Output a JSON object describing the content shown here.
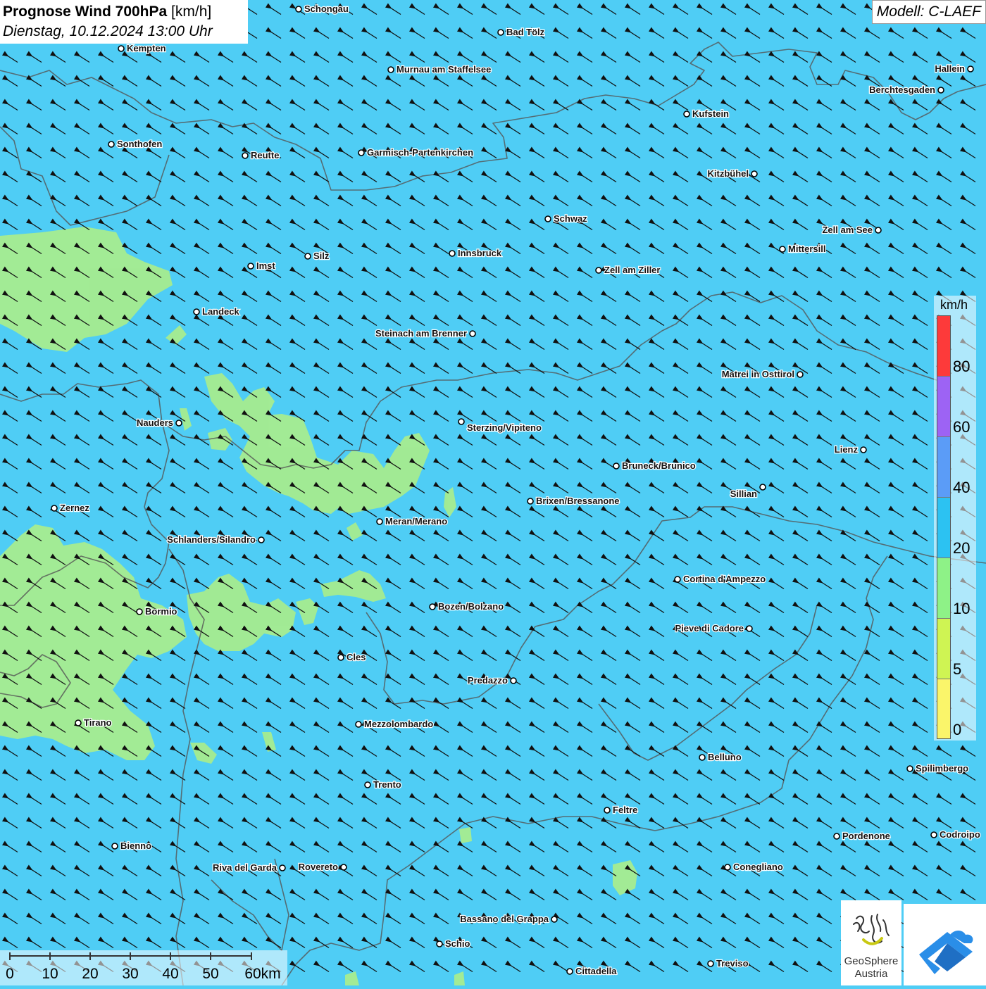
{
  "header": {
    "title_bold": "Prognose Wind 700hPa",
    "title_unit": "[km/h]",
    "datetime": "Dienstag, 10.12.2024 13:00 Uhr"
  },
  "model": "Modell: C-LAEF",
  "legend": {
    "unit": "km/h",
    "labels": [
      "80",
      "60",
      "40",
      "20",
      "10",
      "5",
      "0"
    ],
    "colors": [
      "#fd3a3a",
      "#9d63f4",
      "#5b9cf7",
      "#2cc2f2",
      "#8ef287",
      "#cff453",
      "#faf56a"
    ]
  },
  "scalebar": {
    "labels": [
      "0",
      "10",
      "20",
      "30",
      "40",
      "50",
      "60km"
    ]
  },
  "logos": {
    "geosphere_line1": "GeoSphere",
    "geosphere_line2": "Austria"
  },
  "map": {
    "base_color": "#4fcdf5",
    "low_wind_color": "#a6ec8f",
    "wind_direction": "from south-east (arrows pointing north-west)",
    "cities": [
      {
        "name": "Schongau"
      },
      {
        "name": "Bad Tölz"
      },
      {
        "name": "Kempten"
      },
      {
        "name": "Murnau am Staffelsee"
      },
      {
        "name": "Hallein"
      },
      {
        "name": "Berchtesgaden"
      },
      {
        "name": "Kufstein"
      },
      {
        "name": "Sonthofen"
      },
      {
        "name": "Reutte"
      },
      {
        "name": "Garmisch-Partenkirchen"
      },
      {
        "name": "Kitzbühel"
      },
      {
        "name": "Schwaz"
      },
      {
        "name": "Zell am See"
      },
      {
        "name": "Mittersill"
      },
      {
        "name": "Imst"
      },
      {
        "name": "Silz"
      },
      {
        "name": "Innsbruck"
      },
      {
        "name": "Zell am Ziller"
      },
      {
        "name": "Landeck"
      },
      {
        "name": "Steinach am Brenner"
      },
      {
        "name": "Matrei in Osttirol"
      },
      {
        "name": "Nauders"
      },
      {
        "name": "Sterzing/Vipiteno"
      },
      {
        "name": "Lienz"
      },
      {
        "name": "Bruneck/Brunico"
      },
      {
        "name": "Sillian"
      },
      {
        "name": "Zernez"
      },
      {
        "name": "Brixen/Bressanone"
      },
      {
        "name": "Meran/Merano"
      },
      {
        "name": "Schlanders/Silandro"
      },
      {
        "name": "Cortina d'Ampezzo"
      },
      {
        "name": "Bozen/Bolzano"
      },
      {
        "name": "Bormio"
      },
      {
        "name": "Pieve di Cadore"
      },
      {
        "name": "Cles"
      },
      {
        "name": "Predazzo"
      },
      {
        "name": "Tirano"
      },
      {
        "name": "Mezzolombardo"
      },
      {
        "name": "Belluno"
      },
      {
        "name": "Spilimbergo"
      },
      {
        "name": "Trento"
      },
      {
        "name": "Feltre"
      },
      {
        "name": "Pordenone"
      },
      {
        "name": "Codroipo"
      },
      {
        "name": "Bienno"
      },
      {
        "name": "Riva del Garda"
      },
      {
        "name": "Rovereto"
      },
      {
        "name": "Conegliano"
      },
      {
        "name": "Bassano del Grappa"
      },
      {
        "name": "Schio"
      },
      {
        "name": "Treviso"
      },
      {
        "name": "Cittadella"
      }
    ]
  }
}
